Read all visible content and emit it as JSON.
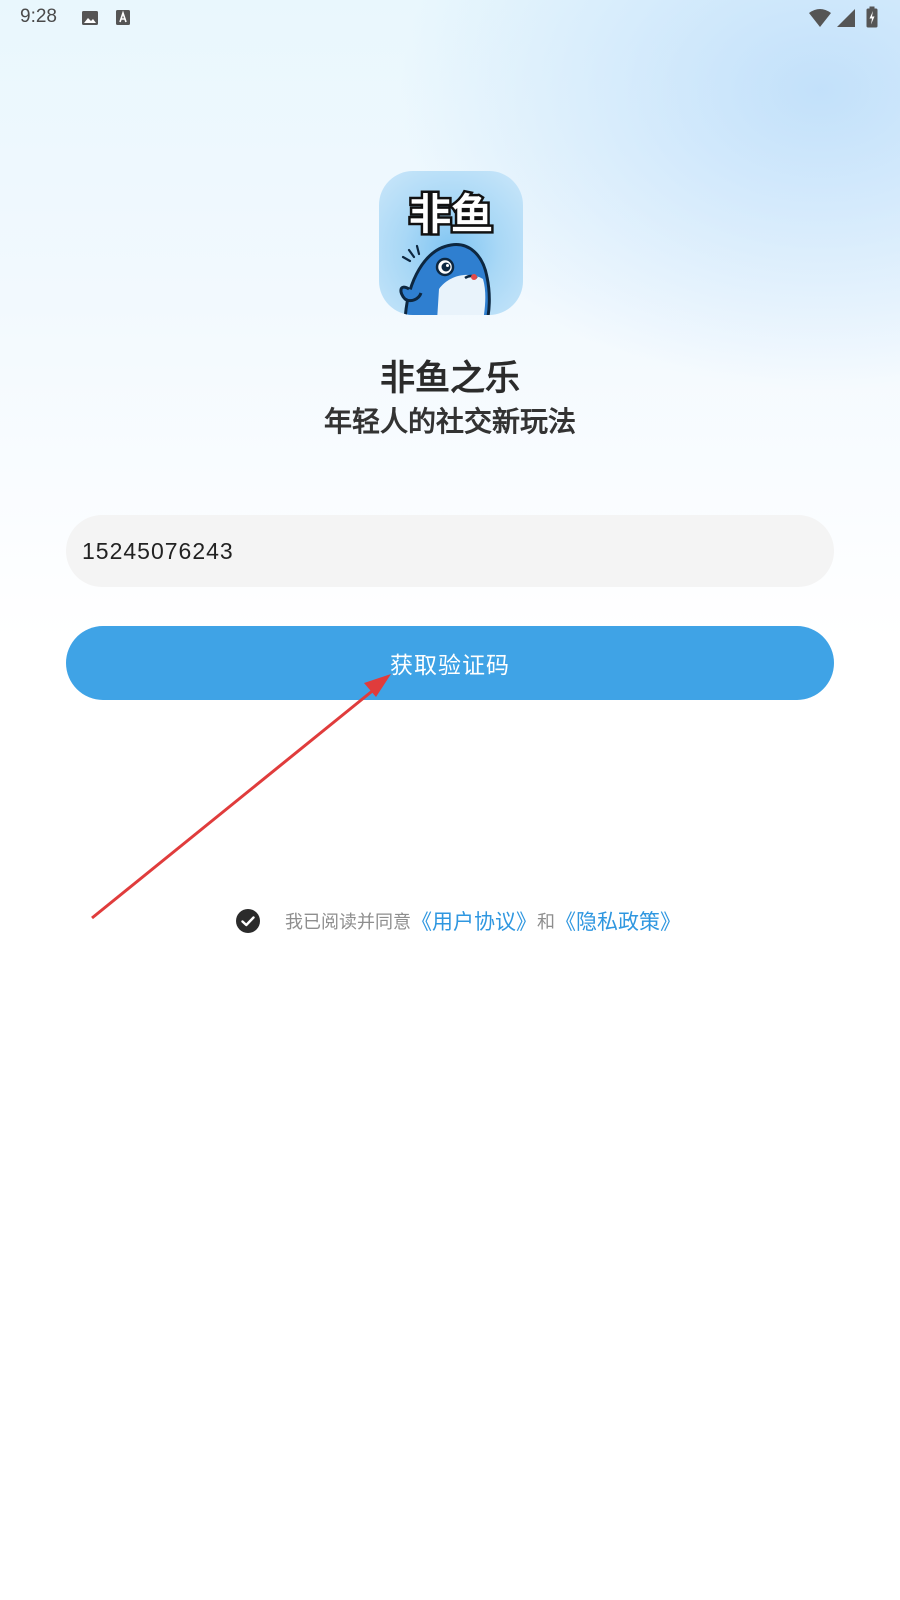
{
  "status_bar": {
    "time": "9:28",
    "left_icons": [
      "image-icon",
      "font-a-icon"
    ],
    "right_icons": [
      "wifi-icon",
      "signal-icon",
      "battery-charging-icon"
    ]
  },
  "app": {
    "logo_text": "非鱼",
    "name": "非鱼之乐",
    "slogan": "年轻人的社交新玩法"
  },
  "login": {
    "phone_value": "15245076243",
    "get_code_label": "获取验证码"
  },
  "agreement": {
    "checked": true,
    "prefix": "我已阅读并同意",
    "user_agreement": "《用户协议》",
    "and": "和",
    "privacy_policy": "《隐私政策》"
  },
  "colors": {
    "accent": "#3fa3e6",
    "link": "#2f97e0",
    "annotation_arrow": "#e03c3c"
  }
}
